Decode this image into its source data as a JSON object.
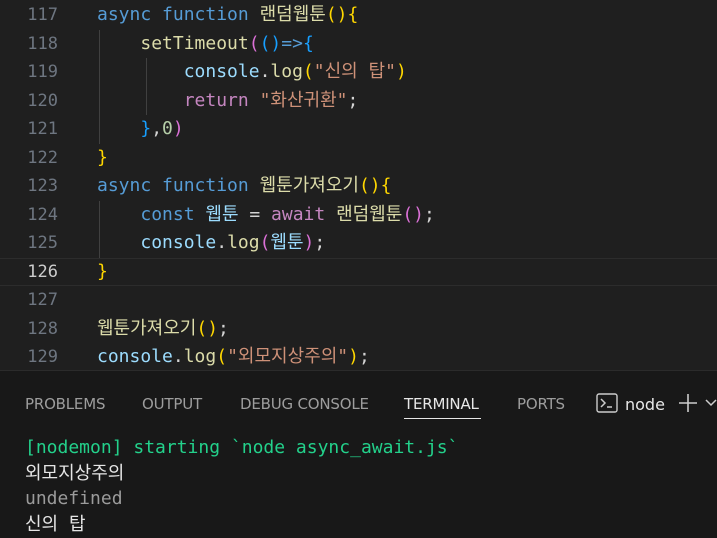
{
  "editor": {
    "lines": [
      {
        "num": "117",
        "active": false,
        "tokens": [
          {
            "t": "async",
            "c": "kw"
          },
          {
            "t": " ",
            "c": "op"
          },
          {
            "t": "function",
            "c": "kw"
          },
          {
            "t": " ",
            "c": "op"
          },
          {
            "t": "랜덤웹툰",
            "c": "fn"
          },
          {
            "t": "()",
            "c": "b1"
          },
          {
            "t": "{",
            "c": "b1"
          }
        ]
      },
      {
        "num": "118",
        "active": false,
        "tokens": [
          {
            "t": "    ",
            "c": "op"
          },
          {
            "t": "setTimeout",
            "c": "fn"
          },
          {
            "t": "(",
            "c": "b2"
          },
          {
            "t": "()",
            "c": "b3"
          },
          {
            "t": "=>",
            "c": "kw"
          },
          {
            "t": "{",
            "c": "b3"
          }
        ]
      },
      {
        "num": "119",
        "active": false,
        "tokens": [
          {
            "t": "        ",
            "c": "op"
          },
          {
            "t": "console",
            "c": "var"
          },
          {
            "t": ".",
            "c": "op"
          },
          {
            "t": "log",
            "c": "fn"
          },
          {
            "t": "(",
            "c": "b1"
          },
          {
            "t": "\"신의 탑\"",
            "c": "str"
          },
          {
            "t": ")",
            "c": "b1"
          }
        ]
      },
      {
        "num": "120",
        "active": false,
        "tokens": [
          {
            "t": "        ",
            "c": "op"
          },
          {
            "t": "return",
            "c": "ctl"
          },
          {
            "t": " ",
            "c": "op"
          },
          {
            "t": "\"화산귀환\"",
            "c": "str"
          },
          {
            "t": ";",
            "c": "op"
          }
        ]
      },
      {
        "num": "121",
        "active": false,
        "tokens": [
          {
            "t": "    ",
            "c": "op"
          },
          {
            "t": "}",
            "c": "b3"
          },
          {
            "t": ",",
            "c": "op"
          },
          {
            "t": "0",
            "c": "num"
          },
          {
            "t": ")",
            "c": "b2"
          }
        ]
      },
      {
        "num": "122",
        "active": false,
        "tokens": [
          {
            "t": "}",
            "c": "b1"
          }
        ]
      },
      {
        "num": "123",
        "active": false,
        "tokens": [
          {
            "t": "async",
            "c": "kw"
          },
          {
            "t": " ",
            "c": "op"
          },
          {
            "t": "function",
            "c": "kw"
          },
          {
            "t": " ",
            "c": "op"
          },
          {
            "t": "웹툰가져오기",
            "c": "fn"
          },
          {
            "t": "()",
            "c": "b1"
          },
          {
            "t": "{",
            "c": "b1"
          }
        ]
      },
      {
        "num": "124",
        "active": false,
        "tokens": [
          {
            "t": "    ",
            "c": "op"
          },
          {
            "t": "const",
            "c": "kw"
          },
          {
            "t": " ",
            "c": "op"
          },
          {
            "t": "웹툰",
            "c": "var"
          },
          {
            "t": " = ",
            "c": "op"
          },
          {
            "t": "await",
            "c": "ctl"
          },
          {
            "t": " ",
            "c": "op"
          },
          {
            "t": "랜덤웹툰",
            "c": "fn"
          },
          {
            "t": "()",
            "c": "b2"
          },
          {
            "t": ";",
            "c": "op"
          }
        ]
      },
      {
        "num": "125",
        "active": false,
        "tokens": [
          {
            "t": "    ",
            "c": "op"
          },
          {
            "t": "console",
            "c": "var"
          },
          {
            "t": ".",
            "c": "op"
          },
          {
            "t": "log",
            "c": "fn"
          },
          {
            "t": "(",
            "c": "b2"
          },
          {
            "t": "웹툰",
            "c": "var"
          },
          {
            "t": ")",
            "c": "b2"
          },
          {
            "t": ";",
            "c": "op"
          }
        ]
      },
      {
        "num": "126",
        "active": true,
        "tokens": [
          {
            "t": "}",
            "c": "b1"
          }
        ]
      },
      {
        "num": "127",
        "active": false,
        "tokens": []
      },
      {
        "num": "128",
        "active": false,
        "tokens": [
          {
            "t": "웹툰가져오기",
            "c": "fn"
          },
          {
            "t": "()",
            "c": "b1"
          },
          {
            "t": ";",
            "c": "op"
          }
        ]
      },
      {
        "num": "129",
        "active": false,
        "tokens": [
          {
            "t": "console",
            "c": "var"
          },
          {
            "t": ".",
            "c": "op"
          },
          {
            "t": "log",
            "c": "fn"
          },
          {
            "t": "(",
            "c": "b1"
          },
          {
            "t": "\"외모지상주의\"",
            "c": "str"
          },
          {
            "t": ")",
            "c": "b1"
          },
          {
            "t": ";",
            "c": "op"
          }
        ]
      }
    ]
  },
  "panel": {
    "tabs": [
      {
        "label": "PROBLEMS",
        "active": false
      },
      {
        "label": "OUTPUT",
        "active": false
      },
      {
        "label": "DEBUG CONSOLE",
        "active": false
      },
      {
        "label": "TERMINAL",
        "active": true
      },
      {
        "label": "PORTS",
        "active": false
      }
    ],
    "terminal_name": "node",
    "icons": {
      "terminal": "terminal-icon",
      "add": "plus-icon",
      "more": "chevron-down-icon"
    }
  },
  "terminal": {
    "lines": [
      {
        "text": "[nodemon] starting `node async_await.js`",
        "kind": "green"
      },
      {
        "text": "외모지상주의",
        "kind": "white"
      },
      {
        "text": "undefined",
        "kind": "gray"
      },
      {
        "text": "신의 탑",
        "kind": "white"
      }
    ]
  },
  "colors": {
    "editor_bg": "#1f1f1f",
    "panel_bg": "#181818",
    "keyword": "#569cd6",
    "control": "#c586c0",
    "function": "#dcdcaa",
    "variable": "#9cdcfe",
    "string": "#ce9178",
    "number": "#b5cea8",
    "bracket_1": "#ffd700",
    "bracket_2": "#da70d6",
    "bracket_3": "#179fff",
    "terminal_green": "#23d18b"
  }
}
